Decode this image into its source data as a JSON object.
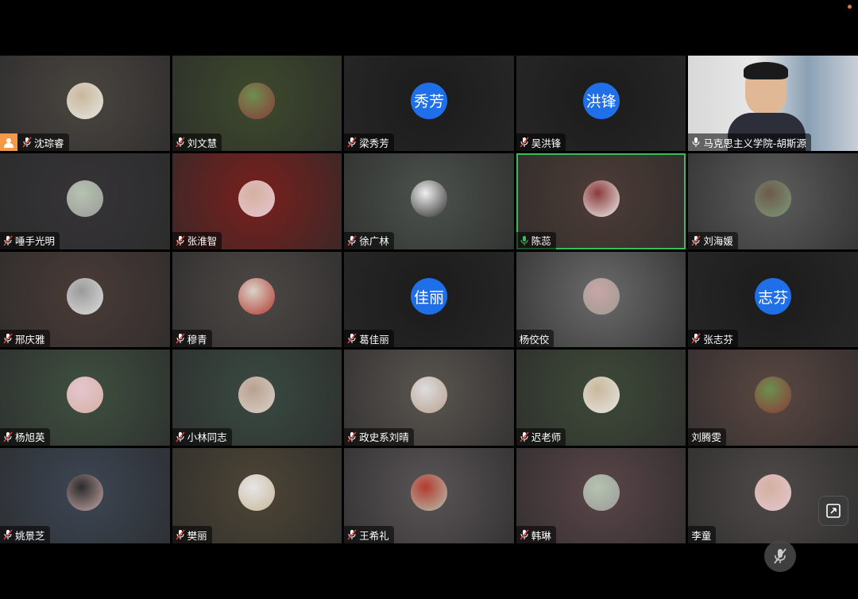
{
  "window": {
    "status_indicator_color": "#e07a2a"
  },
  "participants": [
    {
      "name": "沈琮睿",
      "mic": "muted",
      "avatar": "photo",
      "host": true,
      "bg": "#4a4540"
    },
    {
      "name": "刘文慧",
      "mic": "muted",
      "avatar": "photo",
      "bg": "#3d4a2c"
    },
    {
      "name": "梁秀芳",
      "mic": "muted",
      "avatar": "text",
      "avatar_text": "秀芳",
      "bg": "#1b1b1b"
    },
    {
      "name": "吴洪锋",
      "mic": "muted",
      "avatar": "text",
      "avatar_text": "洪锋",
      "bg": "#1b1b1b"
    },
    {
      "name": "马克思主义学院-胡斯源",
      "mic": "on",
      "avatar": "video",
      "bg": "#c9c9c9"
    },
    {
      "name": "唾手光明",
      "mic": "muted",
      "avatar": "photo",
      "bg": "#353336"
    },
    {
      "name": "张淮智",
      "mic": "muted",
      "avatar": "photo",
      "bg": "#7a1f1c"
    },
    {
      "name": "徐广林",
      "mic": "muted",
      "avatar": "photo",
      "bg": "#4b524c"
    },
    {
      "name": "陈蕊",
      "mic": "active",
      "avatar": "photo",
      "active": true,
      "bg": "#4d3c36"
    },
    {
      "name": "刘海媛",
      "mic": "muted",
      "avatar": "photo",
      "bg": "#5d5d5d"
    },
    {
      "name": "邢庆雅",
      "mic": "muted",
      "avatar": "photo",
      "bg": "#4a3b37"
    },
    {
      "name": "穆青",
      "mic": "muted",
      "avatar": "photo",
      "bg": "#4d4845"
    },
    {
      "name": "葛佳丽",
      "mic": "muted",
      "avatar": "text",
      "avatar_text": "佳丽",
      "bg": "#1b1b1b"
    },
    {
      "name": "杨佼佼",
      "mic": "none",
      "avatar": "photo",
      "bg": "#6a6a6a"
    },
    {
      "name": "张志芬",
      "mic": "muted",
      "avatar": "text",
      "avatar_text": "志芬",
      "bg": "#1b1b1b"
    },
    {
      "name": "杨旭英",
      "mic": "muted",
      "avatar": "photo",
      "bg": "#3f5040"
    },
    {
      "name": "小林同志",
      "mic": "muted",
      "avatar": "photo",
      "bg": "#3a4a42"
    },
    {
      "name": "政史系刘晴",
      "mic": "muted",
      "avatar": "photo",
      "bg": "#5a5550"
    },
    {
      "name": "迟老师",
      "mic": "muted",
      "avatar": "photo",
      "bg": "#3e4a38"
    },
    {
      "name": "刘腾雯",
      "mic": "none",
      "avatar": "photo",
      "bg": "#5a4742"
    },
    {
      "name": "姚景芝",
      "mic": "muted",
      "avatar": "photo",
      "bg": "#3c4654"
    },
    {
      "name": "樊丽",
      "mic": "muted",
      "avatar": "photo",
      "bg": "#4d4535"
    },
    {
      "name": "王希礼",
      "mic": "muted",
      "avatar": "photo",
      "bg": "#5a5556"
    },
    {
      "name": "韩琳",
      "mic": "muted",
      "avatar": "photo",
      "bg": "#5a4548"
    },
    {
      "name": "李童",
      "mic": "none",
      "avatar": "photo",
      "bg": "#4e4a48"
    }
  ],
  "controls": {
    "pip_button_icon": "exit-fullscreen-icon",
    "mute_button_icon": "mic-muted-icon"
  }
}
